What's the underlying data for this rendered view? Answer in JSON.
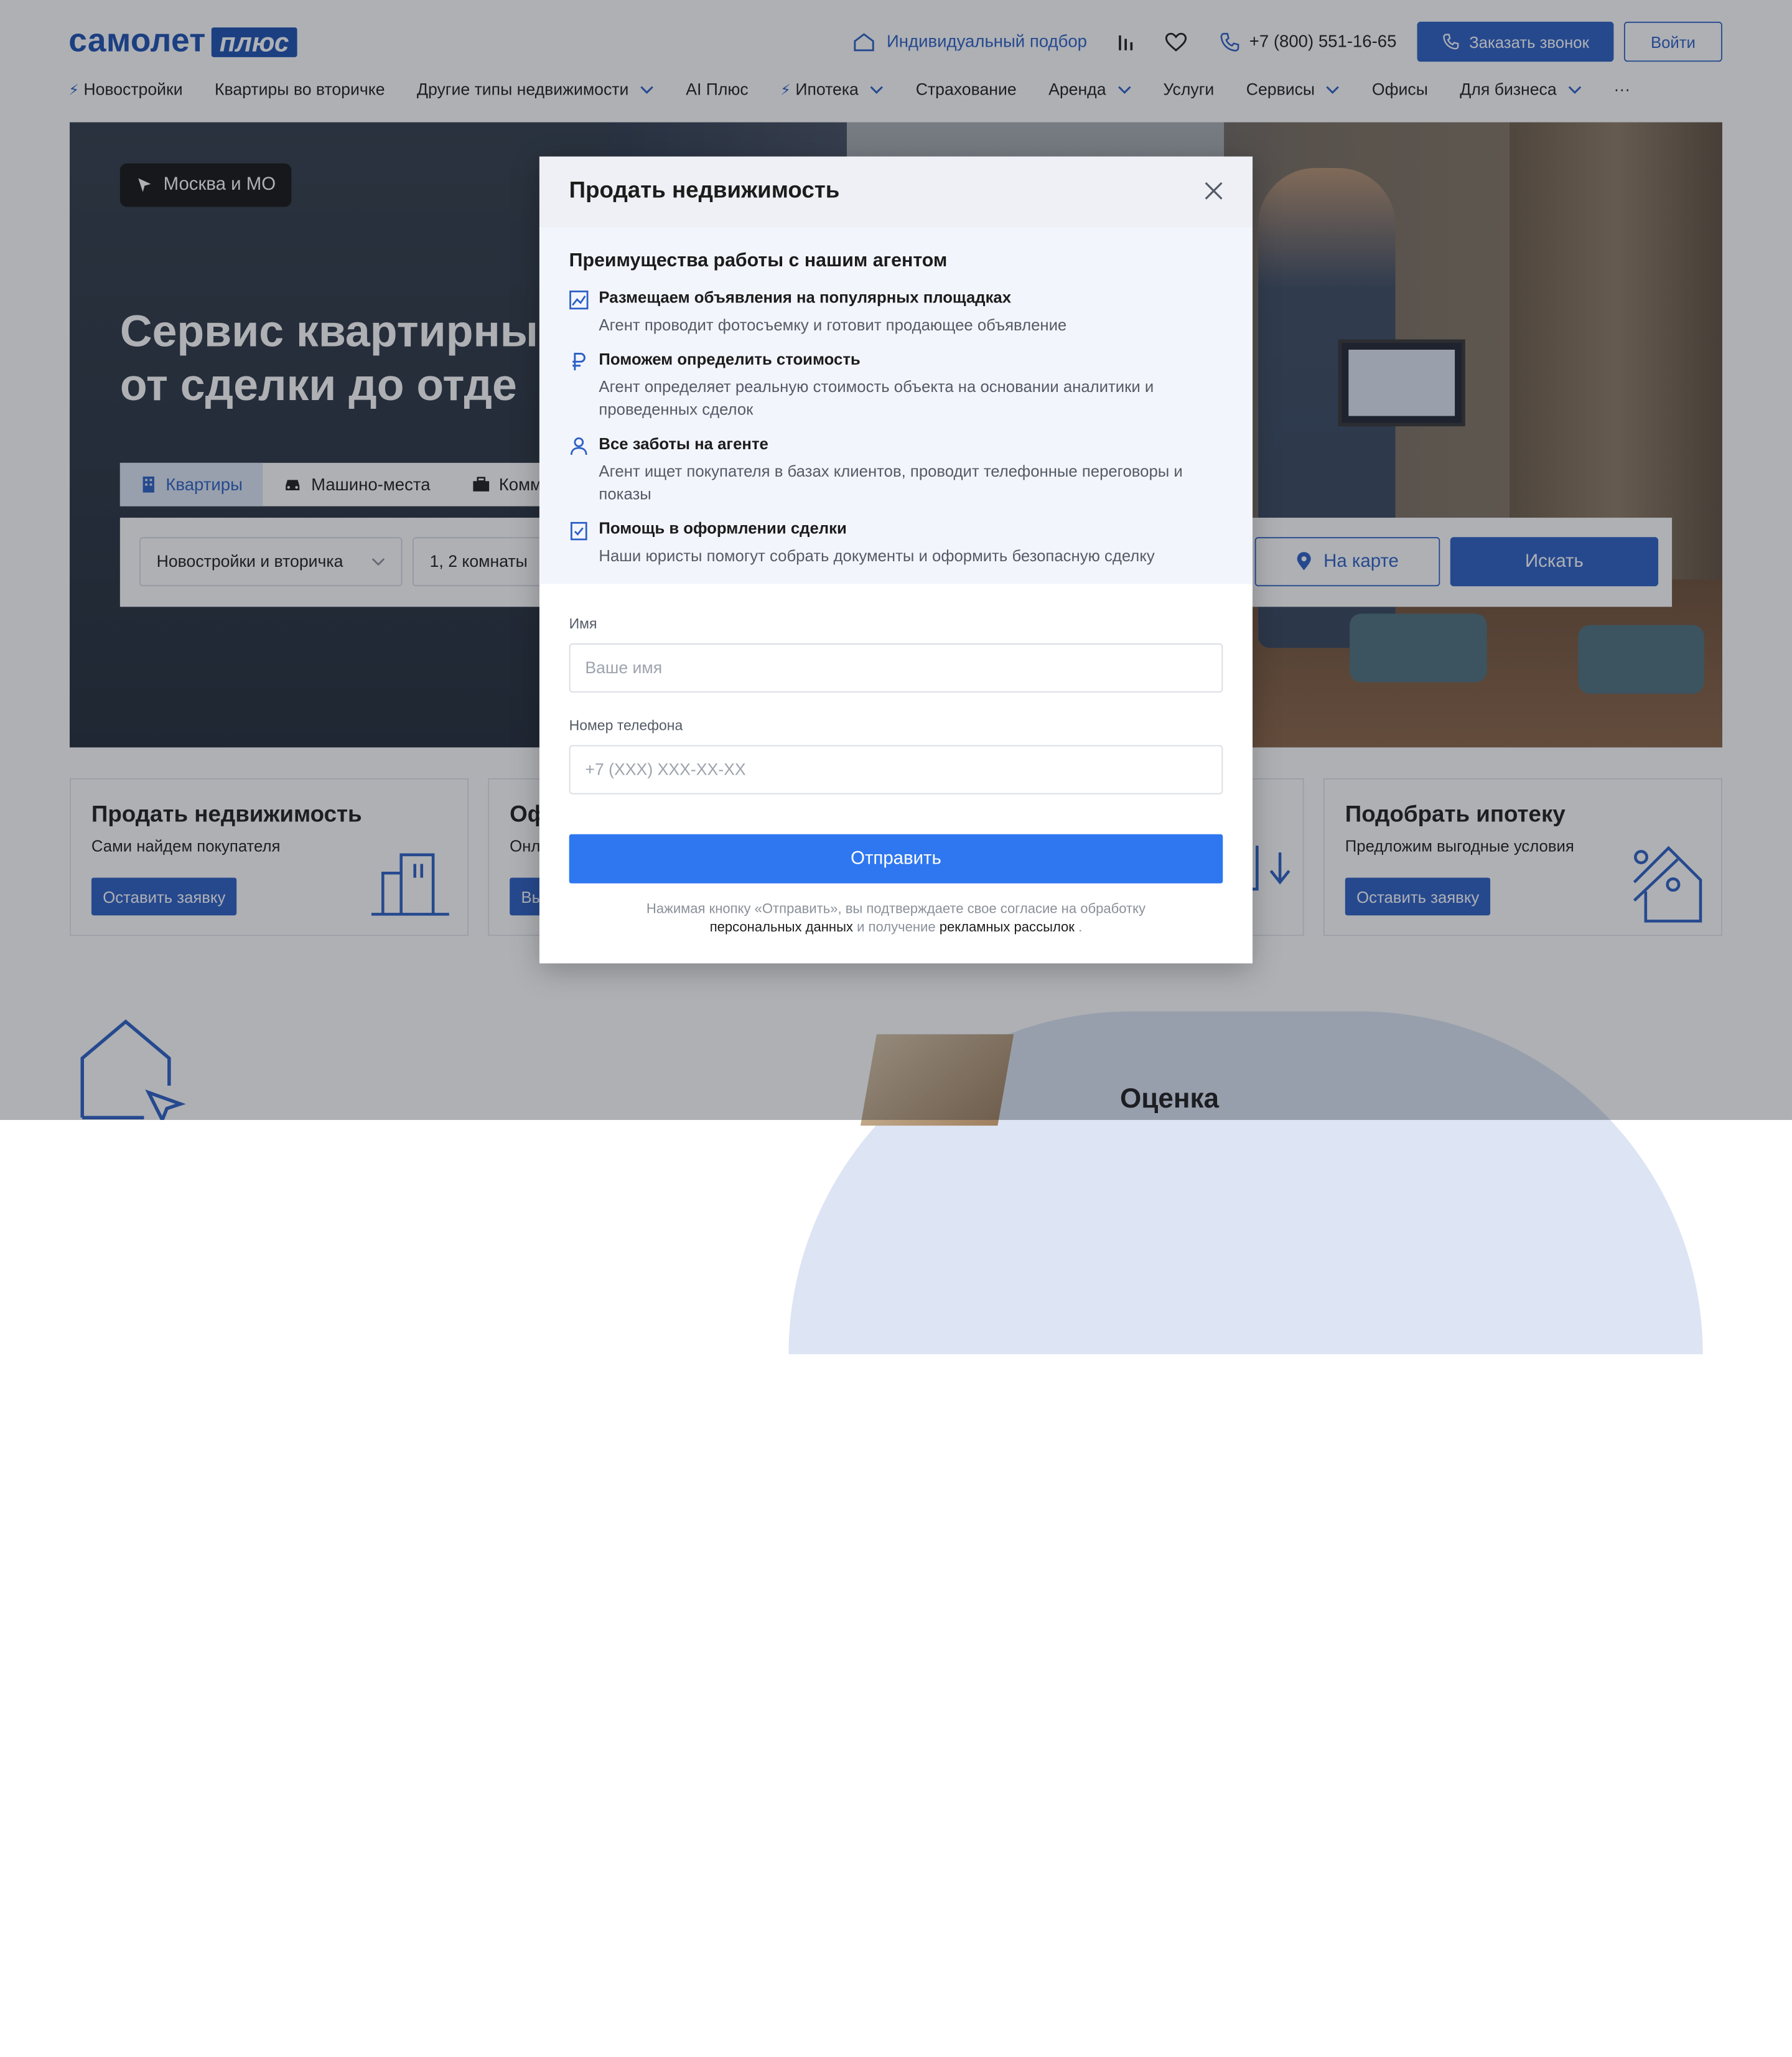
{
  "header": {
    "logo_main": "самолет",
    "logo_plus": "плюс",
    "individual_label": "Индивидуальный подбор",
    "phone": "+7 (800) 551-16-65",
    "call_button": "Заказать звонок",
    "login_button": "Войти"
  },
  "nav": {
    "items": [
      {
        "label": "Новостройки",
        "bolt": true,
        "chevron": false
      },
      {
        "label": "Квартиры во вторичке",
        "bolt": false,
        "chevron": false
      },
      {
        "label": "Другие типы недвижимости",
        "bolt": false,
        "chevron": true
      },
      {
        "label": "AI Плюс",
        "bolt": false,
        "chevron": false
      },
      {
        "label": "Ипотека",
        "bolt": true,
        "chevron": true
      },
      {
        "label": "Страхование",
        "bolt": false,
        "chevron": false
      },
      {
        "label": "Аренда",
        "bolt": false,
        "chevron": true
      },
      {
        "label": "Услуги",
        "bolt": false,
        "chevron": false
      },
      {
        "label": "Сервисы",
        "bolt": false,
        "chevron": true
      },
      {
        "label": "Офисы",
        "bolt": false,
        "chevron": false
      },
      {
        "label": "Для бизнеса",
        "bolt": false,
        "chevron": true
      }
    ],
    "more": "···"
  },
  "hero": {
    "location": "Москва и МО",
    "title_line1": "Сервис квартирны",
    "title_line2": "от сделки до отде",
    "tabs": [
      "Квартиры",
      "Машино-места",
      "Комм"
    ],
    "type_select": "Новостройки и вторичка",
    "rooms_select": "1, 2 комнаты",
    "map_button": "На карте",
    "search_button": "Искать"
  },
  "cards": [
    {
      "title": "Продать недвижимость",
      "subtitle": "Сами найдем покупателя",
      "button": "Оставить заявку"
    },
    {
      "title": "Оф",
      "subtitle": "Онл",
      "button": "Вы"
    },
    {
      "title": "Подобрать ипотеку",
      "subtitle": "Предложим выгодные условия",
      "button": "Оставить заявку"
    }
  ],
  "bottom": {
    "title": "Оценка"
  },
  "modal": {
    "title": "Продать недвижимость",
    "benefits_title": "Преимущества работы с нашим агентом",
    "benefits": [
      {
        "icon": "image-icon",
        "head": "Размещаем объявления на популярных площадках",
        "text": "Агент проводит фотосъемку и готовит продающее объявление"
      },
      {
        "icon": "ruble-icon",
        "head": "Поможем определить стоимость",
        "text": "Агент определяет реальную стоимость объекта на основании аналитики и проведенных сделок"
      },
      {
        "icon": "person-icon",
        "head": "Все заботы на агенте",
        "text": "Агент ищет покупателя в базах клиентов, проводит телефонные переговоры и показы"
      },
      {
        "icon": "document-check-icon",
        "head": "Помощь в оформлении сделки",
        "text": "Наши юристы помогут собрать документы и оформить безопасную сделку"
      }
    ],
    "name_label": "Имя",
    "name_placeholder": "Ваше имя",
    "phone_label": "Номер телефона",
    "phone_placeholder": "+7 (XXX) XXX-XX-XX",
    "submit": "Отправить",
    "consent_part1": "Нажимая кнопку «Отправить», вы подтверждаете свое согласие на обработку",
    "consent_link1": "персональных данных",
    "consent_part2": " и получение ",
    "consent_link2": "рекламных рассылок",
    "consent_part3": " ."
  },
  "colors": {
    "brand": "#2b5fc4",
    "submit": "#2f77f0",
    "overlay": "rgba(30,36,46,0.36)"
  }
}
